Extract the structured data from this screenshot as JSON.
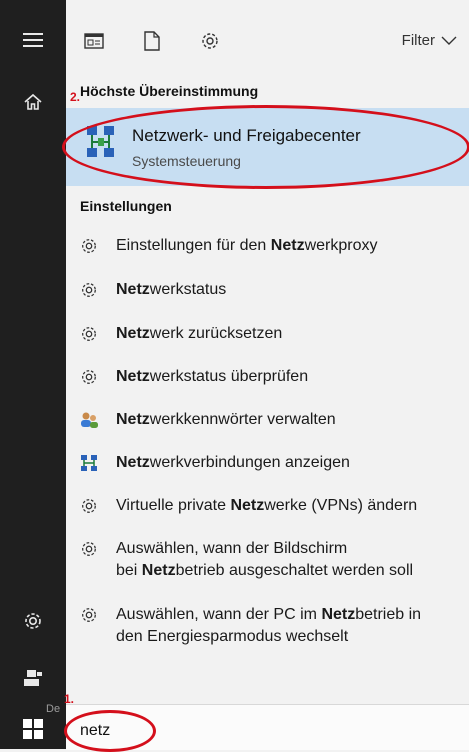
{
  "sidebar": {
    "icons": [
      "hamburger-menu-icon",
      "home-icon",
      "settings-icon",
      "user-icon",
      "windows-start-icon"
    ]
  },
  "topbar": {
    "icons": [
      "document-list-icon",
      "document-icon",
      "settings-icon"
    ],
    "filter_label": "Filter"
  },
  "best_match": {
    "section_label": "Höchste Übereinstimmung",
    "title": "Netzwerk- und Freigabecenter",
    "subtitle": "Systemsteuerung",
    "icon": "network-sharing-icon"
  },
  "settings_section": {
    "section_label": "Einstellungen",
    "items": [
      {
        "icon": "gear-icon",
        "before": "Einstellungen für den ",
        "bold": "Netz",
        "after": "werkproxy"
      },
      {
        "icon": "gear-icon",
        "before": "",
        "bold": "Netz",
        "after": "werkstatus"
      },
      {
        "icon": "gear-icon",
        "before": "",
        "bold": "Netz",
        "after": "werk zurücksetzen"
      },
      {
        "icon": "gear-icon",
        "before": "",
        "bold": "Netz",
        "after": "werkstatus überprüfen"
      },
      {
        "icon": "users-network-icon",
        "before": "",
        "bold": "Netz",
        "after": "werkkennwörter verwalten"
      },
      {
        "icon": "network-connections-icon",
        "before": "",
        "bold": "Netz",
        "after": "werkverbindungen anzeigen"
      },
      {
        "icon": "gear-icon",
        "before": "Virtuelle private ",
        "bold": "Netz",
        "after": "werke (VPNs) ändern"
      },
      {
        "icon": "gear-icon",
        "line1": "Auswählen, wann der Bildschirm",
        "before": "bei ",
        "bold": "Netz",
        "after": "betrieb ausgeschaltet werden soll"
      },
      {
        "icon": "gear-icon",
        "before": "Auswählen, wann der PC im ",
        "bold": "Netz",
        "after": "betrieb in",
        "line2": "den Energiesparmodus wechselt"
      }
    ]
  },
  "search": {
    "query": "netz"
  },
  "annotations": {
    "label_1": "1.",
    "label_2": "2.",
    "color": "#d40f1b"
  },
  "taskbar_ghost_text": "De"
}
